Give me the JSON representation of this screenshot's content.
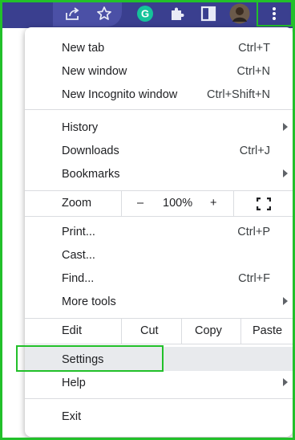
{
  "colors": {
    "toolbar_bg": "#3a3f8f",
    "highlight_outline": "#22c02a",
    "menu_bg": "#ffffff",
    "hover_bg": "#e8eaed"
  },
  "toolbar": {
    "icons": [
      "share-icon",
      "star-icon",
      "grammarly-icon",
      "puzzle-icon",
      "side-panel-icon",
      "avatar",
      "kebab-menu-icon"
    ],
    "grammarly_letter": "G"
  },
  "menu": {
    "new_tab": {
      "label": "New tab",
      "shortcut": "Ctrl+T"
    },
    "new_window": {
      "label": "New window",
      "shortcut": "Ctrl+N"
    },
    "new_incognito": {
      "label": "New Incognito window",
      "shortcut": "Ctrl+Shift+N"
    },
    "history": {
      "label": "History"
    },
    "downloads": {
      "label": "Downloads",
      "shortcut": "Ctrl+J"
    },
    "bookmarks": {
      "label": "Bookmarks"
    },
    "zoom": {
      "label": "Zoom",
      "minus": "–",
      "level": "100%",
      "plus": "+"
    },
    "print": {
      "label": "Print...",
      "shortcut": "Ctrl+P"
    },
    "cast": {
      "label": "Cast..."
    },
    "find": {
      "label": "Find...",
      "shortcut": "Ctrl+F"
    },
    "more_tools": {
      "label": "More tools"
    },
    "edit": {
      "label": "Edit",
      "cut": "Cut",
      "copy": "Copy",
      "paste": "Paste"
    },
    "settings": {
      "label": "Settings"
    },
    "help": {
      "label": "Help"
    },
    "exit": {
      "label": "Exit"
    }
  }
}
